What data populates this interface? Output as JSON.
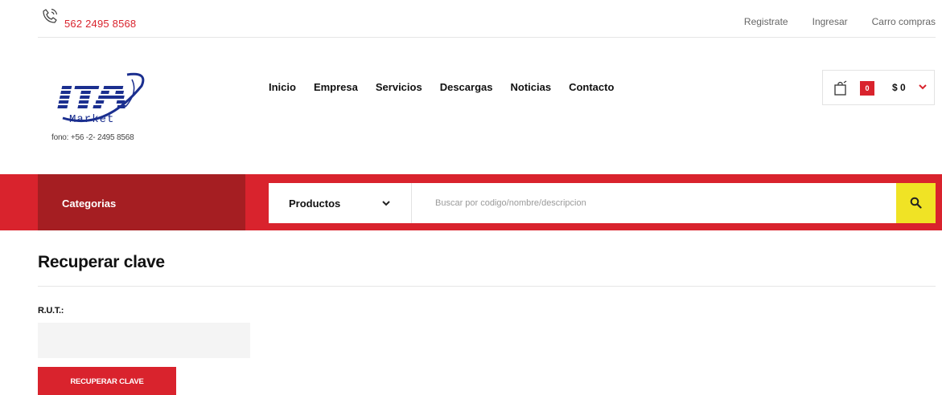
{
  "topbar": {
    "phone_icon": "phone-icon",
    "phone": "562 2495 8568",
    "links": [
      "Registrate",
      "Ingresar",
      "Carro compras"
    ]
  },
  "header": {
    "logo_text": "ITA",
    "logo_subtext": "Market",
    "fono": "fono:  +56 -2- 2495 8568",
    "nav": [
      "Inicio",
      "Empresa",
      "Servicios",
      "Descargas",
      "Noticias",
      "Contacto"
    ],
    "cart": {
      "icon": "shopping-bag-icon",
      "count": "0",
      "total": "$ 0"
    }
  },
  "searchbar": {
    "categories_label": "Categorias",
    "product_select": "Productos",
    "placeholder": "Buscar por codigo/nombre/descripcion",
    "search_icon": "search-icon"
  },
  "form": {
    "title": "Recuperar clave",
    "rut_label": "R.U.T.:",
    "rut_value": "",
    "submit_label": "RECUPERAR CLAVE"
  },
  "colors": {
    "brand_red": "#d9232d",
    "dark_red": "#a51e22",
    "search_yellow": "#f0e325",
    "logo_blue": "#1b2f8f"
  }
}
